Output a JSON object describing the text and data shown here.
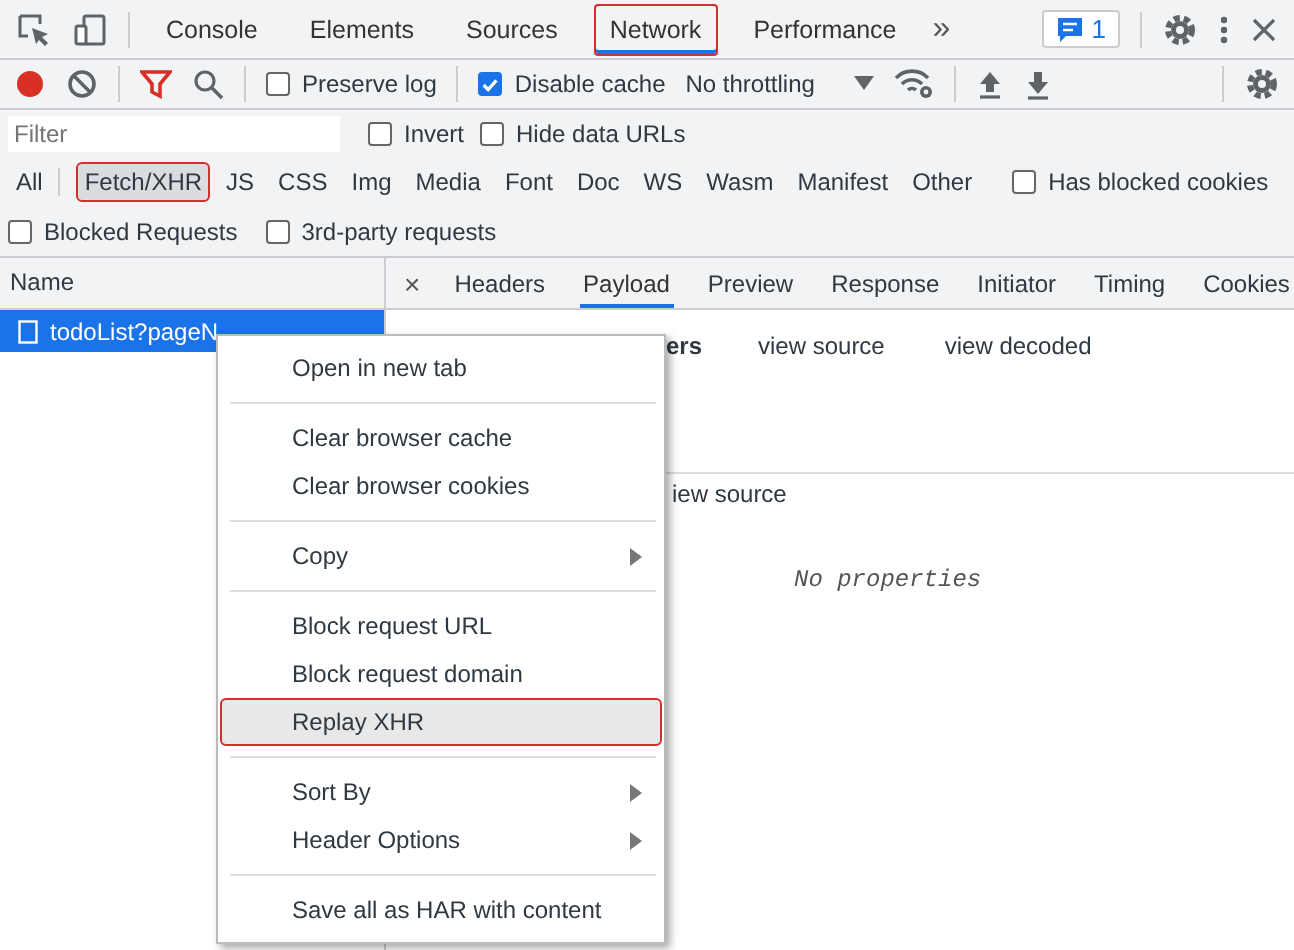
{
  "main_toolbar": {
    "tabs": [
      {
        "label": "Console",
        "selected": false,
        "annotated": false
      },
      {
        "label": "Elements",
        "selected": false,
        "annotated": false
      },
      {
        "label": "Sources",
        "selected": false,
        "annotated": false
      },
      {
        "label": "Network",
        "selected": true,
        "annotated": true
      },
      {
        "label": "Performance",
        "selected": false,
        "annotated": false
      }
    ],
    "more": "»",
    "issues_count": "1"
  },
  "network_toolbar": {
    "recording": true,
    "checkboxes": [
      {
        "label": "Preserve log",
        "checked": false
      },
      {
        "label": "Disable cache",
        "checked": true
      }
    ],
    "throttling": "No throttling"
  },
  "filter_bar": {
    "placeholder": "Filter",
    "options": [
      {
        "label": "Invert",
        "checked": false
      },
      {
        "label": "Hide data URLs",
        "checked": false
      }
    ],
    "types": [
      {
        "label": "All",
        "selected": false,
        "annotated": false
      },
      {
        "label": "Fetch/XHR",
        "selected": true,
        "annotated": true
      },
      {
        "label": "JS",
        "selected": false,
        "annotated": false
      },
      {
        "label": "CSS",
        "selected": false,
        "annotated": false
      },
      {
        "label": "Img",
        "selected": false,
        "annotated": false
      },
      {
        "label": "Media",
        "selected": false,
        "annotated": false
      },
      {
        "label": "Font",
        "selected": false,
        "annotated": false
      },
      {
        "label": "Doc",
        "selected": false,
        "annotated": false
      },
      {
        "label": "WS",
        "selected": false,
        "annotated": false
      },
      {
        "label": "Wasm",
        "selected": false,
        "annotated": false
      },
      {
        "label": "Manifest",
        "selected": false,
        "annotated": false
      },
      {
        "label": "Other",
        "selected": false,
        "annotated": false
      }
    ],
    "type_checkbox": {
      "label": "Has blocked cookies",
      "checked": false
    },
    "more_options": [
      {
        "label": "Blocked Requests",
        "checked": false
      },
      {
        "label": "3rd-party requests",
        "checked": false
      }
    ]
  },
  "requests": {
    "column": "Name",
    "rows": [
      {
        "name": "todoList?pageN",
        "selected": true
      }
    ]
  },
  "detail": {
    "close": "×",
    "tabs": [
      {
        "label": "Headers",
        "selected": false
      },
      {
        "label": "Payload",
        "selected": true
      },
      {
        "label": "Preview",
        "selected": false
      },
      {
        "label": "Response",
        "selected": false
      },
      {
        "label": "Initiator",
        "selected": false
      },
      {
        "label": "Timing",
        "selected": false
      },
      {
        "label": "Cookies",
        "selected": false
      }
    ],
    "section_title": "ers",
    "section_links": [
      "view source",
      "view decoded"
    ],
    "second_link": "iew source",
    "empty": "No properties"
  },
  "context_menu": {
    "groups": [
      [
        {
          "label": "Open in new tab",
          "submenu": false,
          "highlighted": false
        }
      ],
      [
        {
          "label": "Clear browser cache",
          "submenu": false,
          "highlighted": false
        },
        {
          "label": "Clear browser cookies",
          "submenu": false,
          "highlighted": false
        }
      ],
      [
        {
          "label": "Copy",
          "submenu": true,
          "highlighted": false
        }
      ],
      [
        {
          "label": "Block request URL",
          "submenu": false,
          "highlighted": false
        },
        {
          "label": "Block request domain",
          "submenu": false,
          "highlighted": false
        },
        {
          "label": "Replay XHR",
          "submenu": false,
          "highlighted": true
        }
      ],
      [
        {
          "label": "Sort By",
          "submenu": true,
          "highlighted": false
        },
        {
          "label": "Header Options",
          "submenu": true,
          "highlighted": false
        }
      ],
      [
        {
          "label": "Save all as HAR with content",
          "submenu": false,
          "highlighted": false
        }
      ]
    ]
  }
}
